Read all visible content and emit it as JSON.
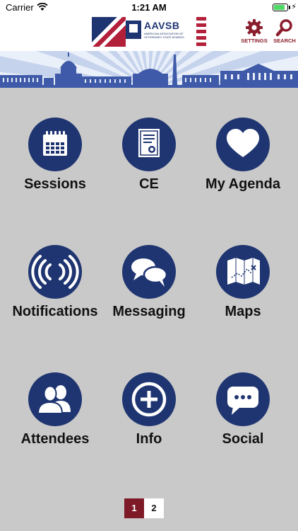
{
  "status_bar": {
    "carrier": "Carrier",
    "time": "1:21 AM",
    "battery_level": 0.85
  },
  "header": {
    "logo_text": "AAVSB",
    "logo_subtitle": "AMERICAN ASSOCIATION OF VETERINARY STATE BOARDS",
    "settings_label": "SETTINGS",
    "search_label": "SEARCH"
  },
  "colors": {
    "accent": "#7e1a27",
    "icon_circle": "#1f3571",
    "background": "#c9c9c9"
  },
  "tiles": [
    {
      "label": "Sessions",
      "icon": "calendar-icon"
    },
    {
      "label": "CE",
      "icon": "certificate-icon"
    },
    {
      "label": "My Agenda",
      "icon": "heart-icon"
    },
    {
      "label": "Notifications",
      "icon": "broadcast-icon"
    },
    {
      "label": "Messaging",
      "icon": "chat-bubbles-icon"
    },
    {
      "label": "Maps",
      "icon": "map-icon"
    },
    {
      "label": "Attendees",
      "icon": "people-icon"
    },
    {
      "label": "Info",
      "icon": "plus-circle-icon"
    },
    {
      "label": "Social",
      "icon": "speech-bubble-icon"
    }
  ],
  "pager": {
    "pages": [
      "1",
      "2"
    ],
    "current": "1"
  }
}
